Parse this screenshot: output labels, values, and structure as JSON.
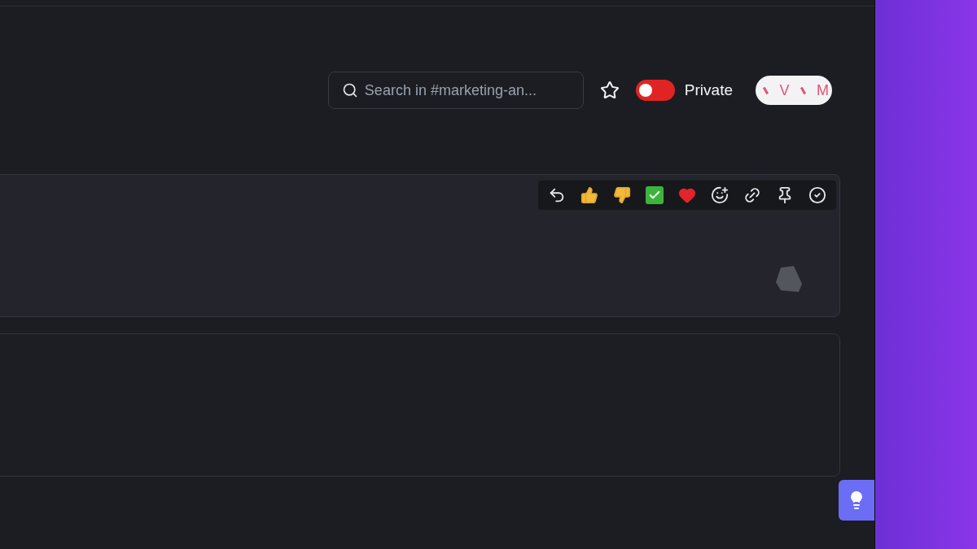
{
  "header": {
    "search": {
      "placeholder": "Search in #marketing-an..."
    },
    "starred": false,
    "privacy": {
      "label": "Private",
      "on": false
    },
    "avatars": [
      {
        "kind": "glyph"
      },
      {
        "kind": "letter",
        "initial": "V"
      },
      {
        "kind": "glyph"
      },
      {
        "kind": "letter",
        "initial": "M"
      }
    ]
  },
  "message_toolbar": {
    "actions": [
      {
        "kind": "reply"
      },
      {
        "kind": "thumbs-up"
      },
      {
        "kind": "thumbs-down"
      },
      {
        "kind": "check"
      },
      {
        "kind": "heart"
      },
      {
        "kind": "add-reaction"
      },
      {
        "kind": "link"
      },
      {
        "kind": "pin"
      },
      {
        "kind": "add-task"
      }
    ]
  }
}
